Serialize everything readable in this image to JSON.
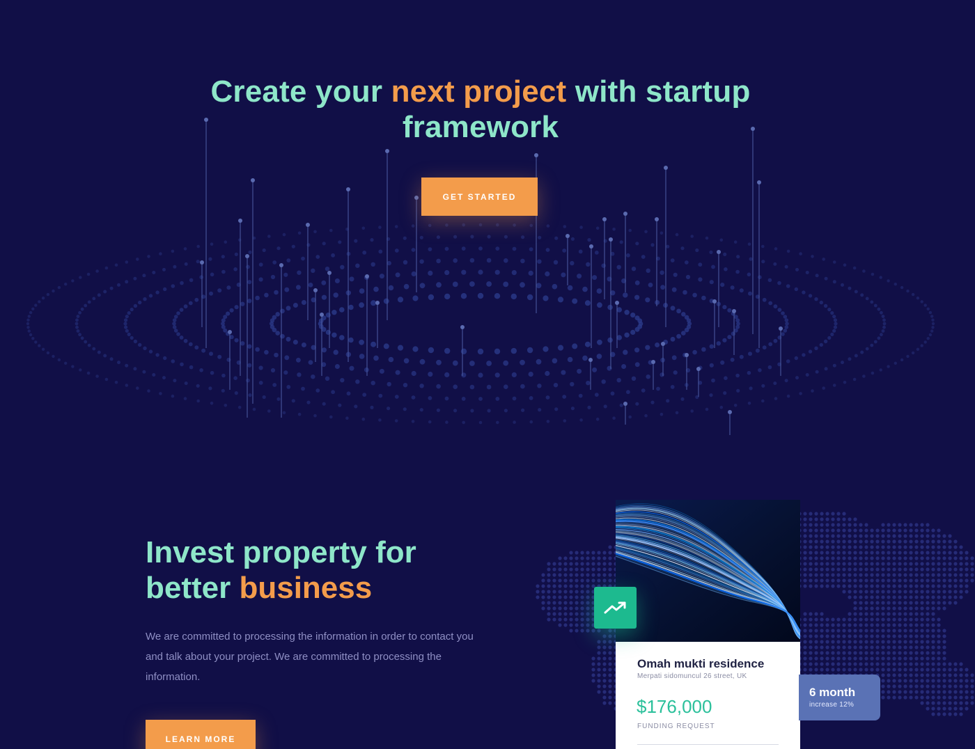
{
  "hero": {
    "title_part1": "Create your ",
    "title_accent": "next project",
    "title_part2": " with startup framework",
    "cta_label": "GET STARTED"
  },
  "invest": {
    "title_part1": "Invest property for better ",
    "title_accent": "business",
    "description": "We are committed to processing the information in order to contact you and talk about your project. We are committed to processing the information.",
    "cta_label": "LEARN MORE"
  },
  "property_card": {
    "name": "Omah mukti residence",
    "address": "Merpati sidomuncul 26 street, UK",
    "price": "$176,000",
    "price_label": "FUNDING REQUEST",
    "trend_icon": "trending-up-icon"
  },
  "duration_badge": {
    "title": "6 month",
    "subtitle": "increase 12%"
  },
  "colors": {
    "background": "#110f47",
    "mint": "#8ee6c9",
    "orange": "#f39c4b",
    "green": "#1dba8f",
    "badge_blue": "#5a72b5"
  }
}
